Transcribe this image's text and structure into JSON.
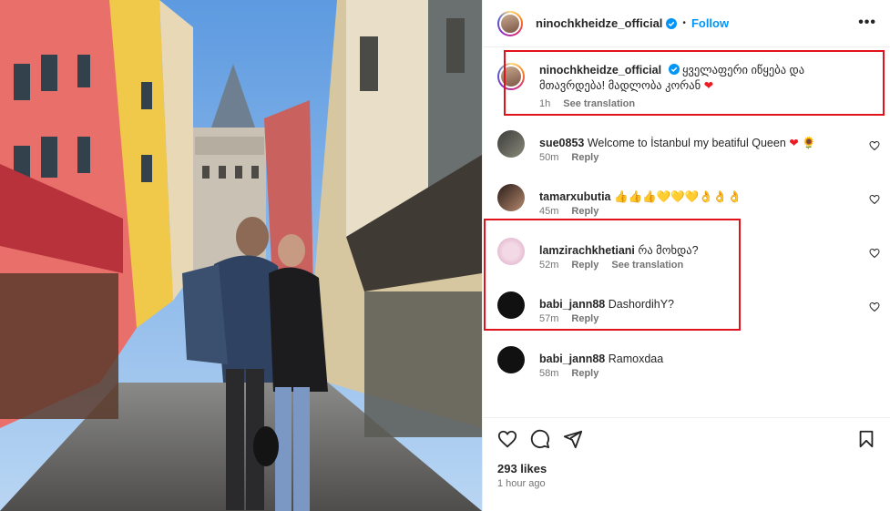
{
  "post": {
    "username": "ninochkheidze_official",
    "follow_label": "Follow",
    "more_label": "•••",
    "dot": "•"
  },
  "caption": {
    "username": "ninochkheidze_official",
    "text": "ყველაფერი იწყება და მთავრდება! მადლობა კორან",
    "time": "1h",
    "see_translation": "See translation"
  },
  "comments": [
    {
      "username": "sue0853",
      "text": "Welcome to İstanbul my beatiful Queen",
      "emoji": "🌻",
      "time": "50m",
      "reply": "Reply",
      "see_translation": ""
    },
    {
      "username": "tamarxubutia",
      "text": "👍👍👍💛💛💛👌👌👌",
      "emoji": "",
      "time": "45m",
      "reply": "Reply",
      "see_translation": ""
    },
    {
      "username": "lamzirachkhetiani",
      "text": "რა მოხდა?",
      "emoji": "",
      "time": "52m",
      "reply": "Reply",
      "see_translation": "See translation"
    },
    {
      "username": "babi_jann88",
      "text": "DashordihY?",
      "emoji": "",
      "time": "57m",
      "reply": "Reply",
      "see_translation": ""
    },
    {
      "username": "babi_jann88",
      "text": "Ramoxdaa",
      "emoji": "",
      "time": "58m",
      "reply": "Reply",
      "see_translation": ""
    }
  ],
  "footer": {
    "likes": "293 likes",
    "time": "1 hour ago"
  },
  "colors": {
    "accent_blue": "#0095f6",
    "highlight_red": "#e0121c",
    "heart_red": "#ed1c24"
  },
  "icons": [
    "verified-badge-icon",
    "heart-icon",
    "comment-icon",
    "share-icon",
    "bookmark-icon",
    "more-options-icon"
  ]
}
